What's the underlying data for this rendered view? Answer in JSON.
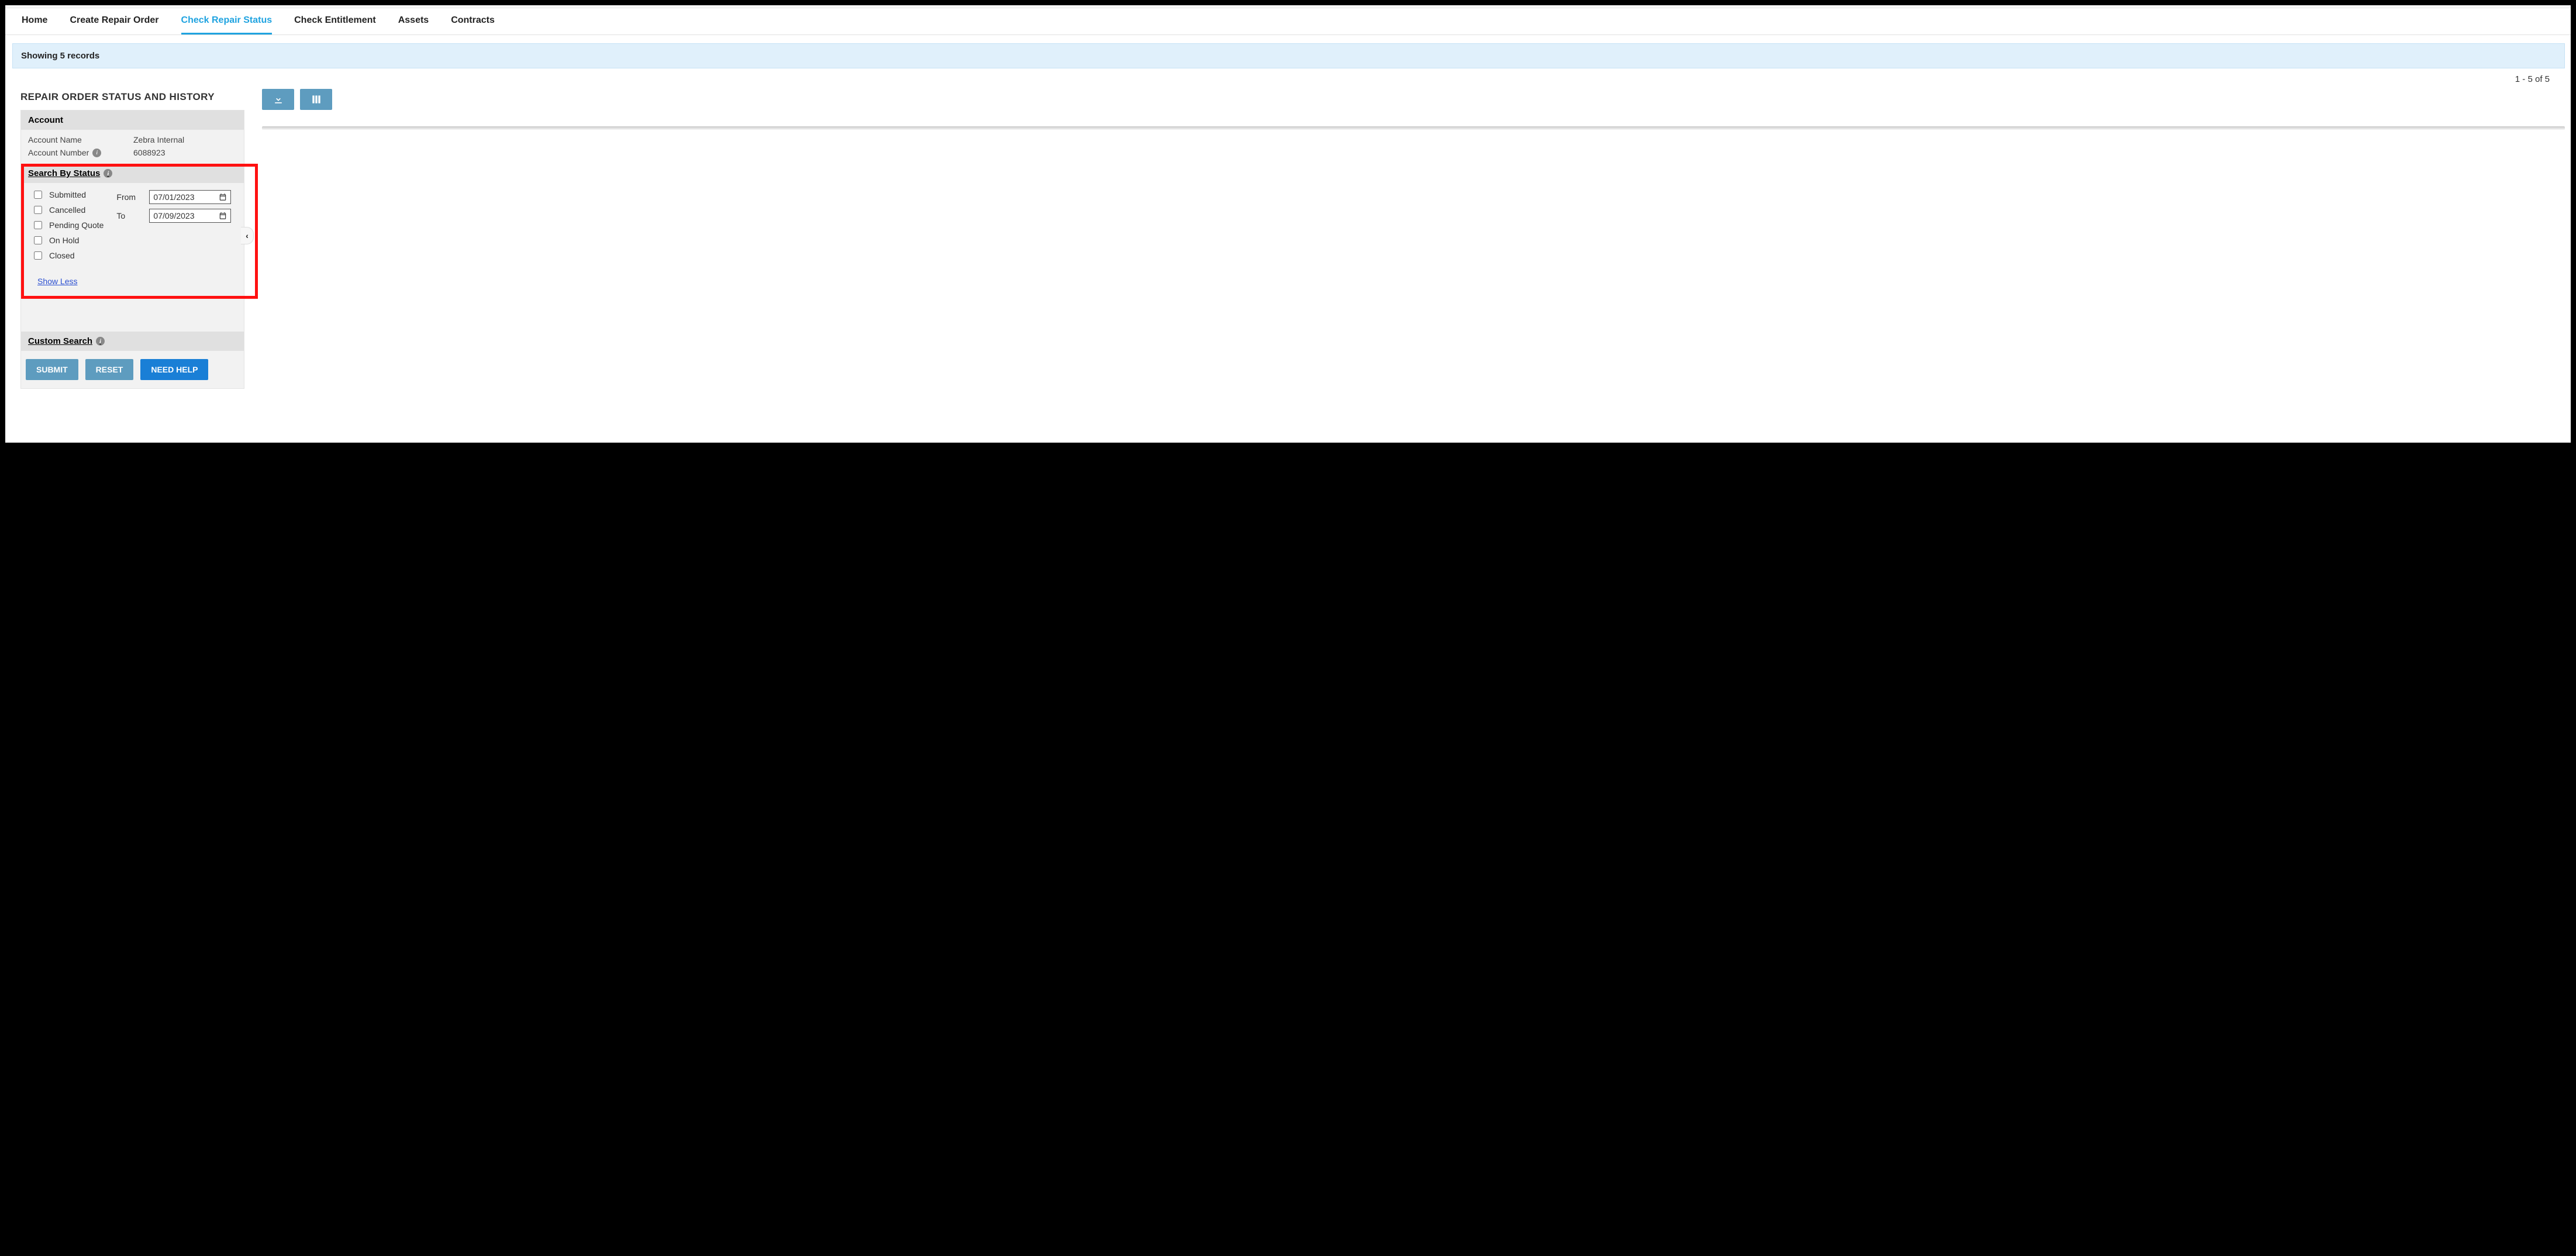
{
  "nav": {
    "home": "Home",
    "create": "Create Repair Order",
    "check_status": "Check Repair Status",
    "entitlement": "Check Entitlement",
    "assets": "Assets",
    "contracts": "Contracts"
  },
  "records_bar": "Showing 5 records",
  "page_info": "1 - 5 of 5",
  "page_title": "REPAIR ORDER STATUS AND HISTORY",
  "account": {
    "header": "Account",
    "name_label": "Account Name",
    "name_value": "Zebra Internal",
    "number_label": "Account Number",
    "number_value": "6088923"
  },
  "search_status": {
    "header": "Search By Status",
    "options": {
      "submitted": "Submitted",
      "cancelled": "Cancelled",
      "pending_quote": "Pending Quote",
      "on_hold": "On Hold",
      "closed": "Closed"
    },
    "from_label": "From",
    "to_label": "To",
    "from_value": "07/01/2023",
    "to_value": "07/09/2023",
    "show_less": "Show Less"
  },
  "custom_search": {
    "header": "Custom Search"
  },
  "buttons": {
    "submit": "SUBMIT",
    "reset": "RESET",
    "need_help": "NEED HELP"
  },
  "icons": {
    "download": "download-icon",
    "columns": "columns-icon",
    "info": "i",
    "calendar": "calendar-icon",
    "collapse": "‹"
  }
}
